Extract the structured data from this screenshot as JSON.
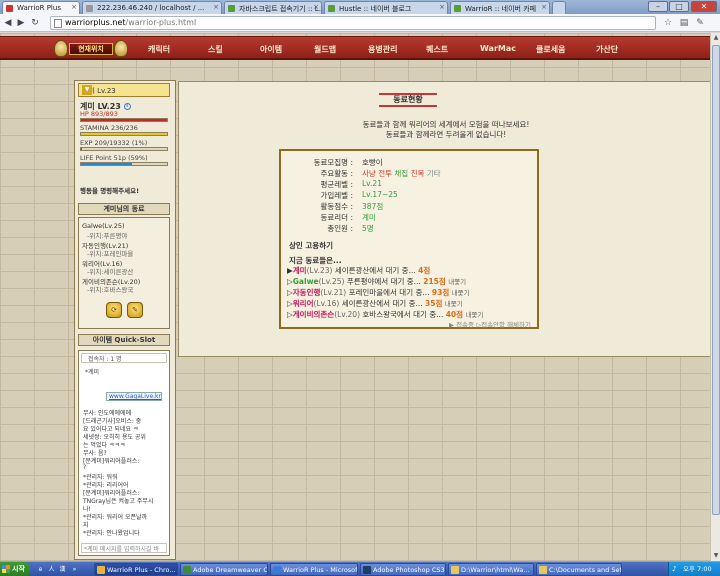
{
  "browser": {
    "tabs": [
      {
        "title": "WarrioR Plus",
        "active": true
      },
      {
        "title": "222.236.46.240 / localhost / ...",
        "active": false
      },
      {
        "title": "자바스크립트 접속기기 :: L...",
        "active": false
      },
      {
        "title": "Hustle :: 네이버 블로그",
        "active": false
      },
      {
        "title": "WarrioR :: 네이버 카페",
        "active": false
      }
    ],
    "url_domain": "warriorplus.net",
    "url_path": "/warrior-plus.html"
  },
  "site": {
    "logo_text": "현재위치",
    "nav": [
      "캐릭터",
      "스킬",
      "아이템",
      "월드맵",
      "용병관리",
      "퀘스트",
      "WarMac",
      "클로세움",
      "가산단"
    ]
  },
  "sidebar": {
    "char_select": "계미 Lv.23",
    "char_name": "계미 LV.23",
    "hp": "HP 893/893",
    "stamina": "STAMINA 236/236",
    "exp": "EXP 209/19332 (1%)",
    "life": "LIFE Point 51p (59%)",
    "exp_percent": 1,
    "life_percent": 59,
    "notice": "행동을 명령해주세요!",
    "friends_title": "계미님의 동료",
    "friends": [
      {
        "name": "Galwe(Lv.25)",
        "loc": "-위치:푸른평야"
      },
      {
        "name": "자동인행(Lv.21)",
        "loc": "-위치:포레인마을"
      },
      {
        "name": "워리어(Lv.16)",
        "loc": "-위치:세이른광산"
      },
      {
        "name": "게이비의존슨(Lv.20)",
        "loc": "-위치:호바스왕국"
      }
    ],
    "quickslot_title": "아이템 Quick-Slot",
    "chat_count": "접속자 : 1 명",
    "chat_user": "*계미",
    "gagalive": "www.GagaLive.kr",
    "chat_lines": [
      "무사: 인도에에에에",
      "[드래곤기사]오비스: 중",
      "요 있어다고 되네요 ㅋ",
      "세넷쌍: 오히히 용도 공위",
      "는 먹었다 ㅋㅋㅋ",
      "무사: 음?",
      "[문계미]워리어플러스:",
      "?",
      "*관리자: 워워",
      "*관리자: 리리어어",
      "[문계미]워리어플러스:",
      "TNGray님은 켜놓고 주무시",
      "나!",
      "*관리자: 워리어 오픈날까",
      "지",
      "*관리자: 안나왔업니다"
    ],
    "chat_input": "*계미 메시지를 입력하시길 바"
  },
  "main": {
    "title": "동료현황",
    "intro1": "동료들과 함께 워리어의 세계에서 모험을 떠나보세요!",
    "intro2": "동료들과 함께라면 두려울게 없습니다!",
    "rows": [
      {
        "label": "동료모집명 :",
        "value": "호빵이"
      },
      {
        "label": "주요활동 :",
        "value": "사냥 전투 채집 친목 기타"
      },
      {
        "label": "평균레벨 :",
        "value": "Lv.21"
      },
      {
        "label": "가입레벨 :",
        "value": "Lv.17~25"
      },
      {
        "label": "활동점수 :",
        "value": "387점"
      },
      {
        "label": "동료리더 :",
        "value": "계미"
      },
      {
        "label": "총인원 :",
        "value": "5명"
      }
    ],
    "activity_words": [
      "사냥",
      "전투",
      "채집",
      "친목",
      "기타"
    ],
    "invite_label": "상인 고용하기",
    "members_head": "지금 동료들은...",
    "members": [
      {
        "name": "계미",
        "lv": "(Lv.23)",
        "loc": "세이른광산에서 대기 중...",
        "pts": "4점",
        "kick": "",
        "color": "#c2185b"
      },
      {
        "name": "Galwe",
        "lv": "(Lv.25)",
        "loc": "푸른평야에서 대기 중...",
        "pts": "215점",
        "kick": "내쫓기",
        "color": "#3a9b3a"
      },
      {
        "name": "자동인행",
        "lv": "(Lv.21)",
        "loc": "포레인마을에서 대기 중...",
        "pts": "93점",
        "kick": "내쫓기",
        "color": "#c2185b"
      },
      {
        "name": "워리어",
        "lv": "(Lv.16)",
        "loc": "세이른광산에서 대기 중...",
        "pts": "35점",
        "kick": "내쫓기",
        "color": "#c2185b"
      },
      {
        "name": "게이비의존슨",
        "lv": "(Lv.20)",
        "loc": "호바스왕국에서 대기 중...",
        "pts": "40점",
        "kick": "내쫓기",
        "color": "#c2185b"
      }
    ],
    "footnote": "▶ 접속중 ▷접속안함 해체하기"
  },
  "taskbar": {
    "start": "시작",
    "tasks": [
      {
        "label": "WarrioR Plus - Chro...",
        "active": true
      },
      {
        "label": "Adobe Dreamweaver C...",
        "active": false
      },
      {
        "label": "WarrioR Plus - Microsoft...",
        "active": false
      },
      {
        "label": "Adobe Photoshop CS3 ...",
        "active": false
      },
      {
        "label": "D:\\Warrior\\html\\Wa...",
        "active": false
      },
      {
        "label": "C:\\Documents and Set...",
        "active": false
      }
    ],
    "clock": "오후 7:00"
  },
  "colors": {
    "nav_bg": "#a12a20",
    "accent_red": "#d03a2a",
    "accent_orange": "#d96b16",
    "page_bg": "#d6ceb6"
  }
}
